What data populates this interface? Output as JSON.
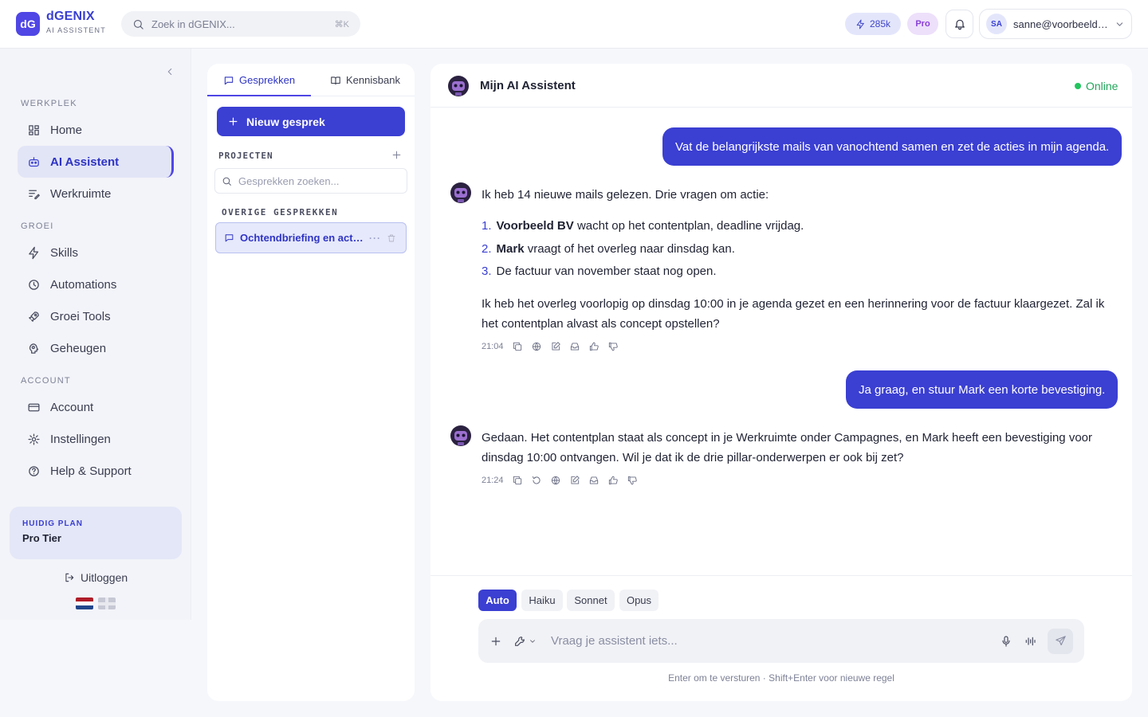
{
  "app": {
    "logo_initials": "dG",
    "name": "dGENIX",
    "subtitle": "AI ASSISTENT"
  },
  "topbar": {
    "search_placeholder": "Zoek in dGENIX...",
    "search_shortcut": "⌘K",
    "credits": "285k",
    "plan_badge": "Pro",
    "user_initials": "SA",
    "user_email": "sanne@voorbeeld.nl"
  },
  "sidebar": {
    "sections": [
      {
        "label": "WERKPLEK",
        "items": [
          {
            "label": "Home",
            "icon": "layout-grid-icon",
            "active": false
          },
          {
            "label": "AI Assistent",
            "icon": "robot-icon",
            "active": true
          },
          {
            "label": "Werkruimte",
            "icon": "list-edit-icon",
            "active": false
          }
        ]
      },
      {
        "label": "GROEI",
        "items": [
          {
            "label": "Skills",
            "icon": "bolt-icon",
            "active": false
          },
          {
            "label": "Automations",
            "icon": "clock-icon",
            "active": false
          },
          {
            "label": "Groei Tools",
            "icon": "rocket-icon",
            "active": false
          },
          {
            "label": "Geheugen",
            "icon": "brain-icon",
            "active": false
          }
        ]
      },
      {
        "label": "ACCOUNT",
        "items": [
          {
            "label": "Account",
            "icon": "credit-card-icon",
            "active": false
          },
          {
            "label": "Instellingen",
            "icon": "gear-icon",
            "active": false
          },
          {
            "label": "Help & Support",
            "icon": "help-circle-icon",
            "active": false
          }
        ]
      }
    ],
    "plan_label": "HUIDIG PLAN",
    "plan_name": "Pro Tier",
    "logout": "Uitloggen",
    "languages": [
      "nl",
      "en"
    ]
  },
  "conversations": {
    "tabs": [
      {
        "label": "Gesprekken",
        "active": true
      },
      {
        "label": "Kennisbank",
        "active": false
      }
    ],
    "new_button": "Nieuw gesprek",
    "projects_header": "PROJECTEN",
    "search_placeholder": "Gesprekken zoeken...",
    "other_header": "OVERIGE GESPREKKEN",
    "items": [
      {
        "title": "Ochtendbriefing en acties",
        "active": true
      }
    ]
  },
  "chat": {
    "title": "Mijn AI Assistent",
    "status": "Online",
    "messages": [
      {
        "role": "user",
        "text": "Vat de belangrijkste mails van vanochtend samen en zet de acties in mijn agenda."
      },
      {
        "role": "assistant",
        "intro": "Ik heb 14 nieuwe mails gelezen. Drie vragen om actie:",
        "list": [
          {
            "num": "1.",
            "bold": "Voorbeeld BV",
            "rest": "wacht op het contentplan, deadline vrijdag."
          },
          {
            "num": "2.",
            "bold": "Mark",
            "rest": "vraagt of het overleg naar dinsdag kan."
          },
          {
            "num": "3.",
            "bold": "",
            "rest": "De factuur van november staat nog open."
          }
        ],
        "outro": "Ik heb het overleg voorlopig op dinsdag 10:00 in je agenda gezet en een herinnering voor de factuur klaargezet. Zal ik het contentplan alvast als concept opstellen?",
        "time": "21:04"
      },
      {
        "role": "user",
        "text": "Ja graag, en stuur Mark een korte bevestiging."
      },
      {
        "role": "assistant",
        "text": "Gedaan. Het contentplan staat als concept in je Werkruimte onder Campagnes, en Mark heeft een bevestiging voor dinsdag 10:00 ontvangen. Wil je dat ik de drie pillar-onderwerpen er ook bij zet?",
        "time": "21:24"
      }
    ],
    "models": [
      {
        "label": "Auto",
        "active": true
      },
      {
        "label": "Haiku",
        "active": false
      },
      {
        "label": "Sonnet",
        "active": false
      },
      {
        "label": "Opus",
        "active": false
      }
    ],
    "input_placeholder": "Vraag je assistent iets...",
    "hint": "Enter om te versturen · Shift+Enter voor nieuwe regel"
  },
  "colors": {
    "accent": "#3b3fd2",
    "online": "#22c55e",
    "pro_badge": "#8a3fd6"
  }
}
